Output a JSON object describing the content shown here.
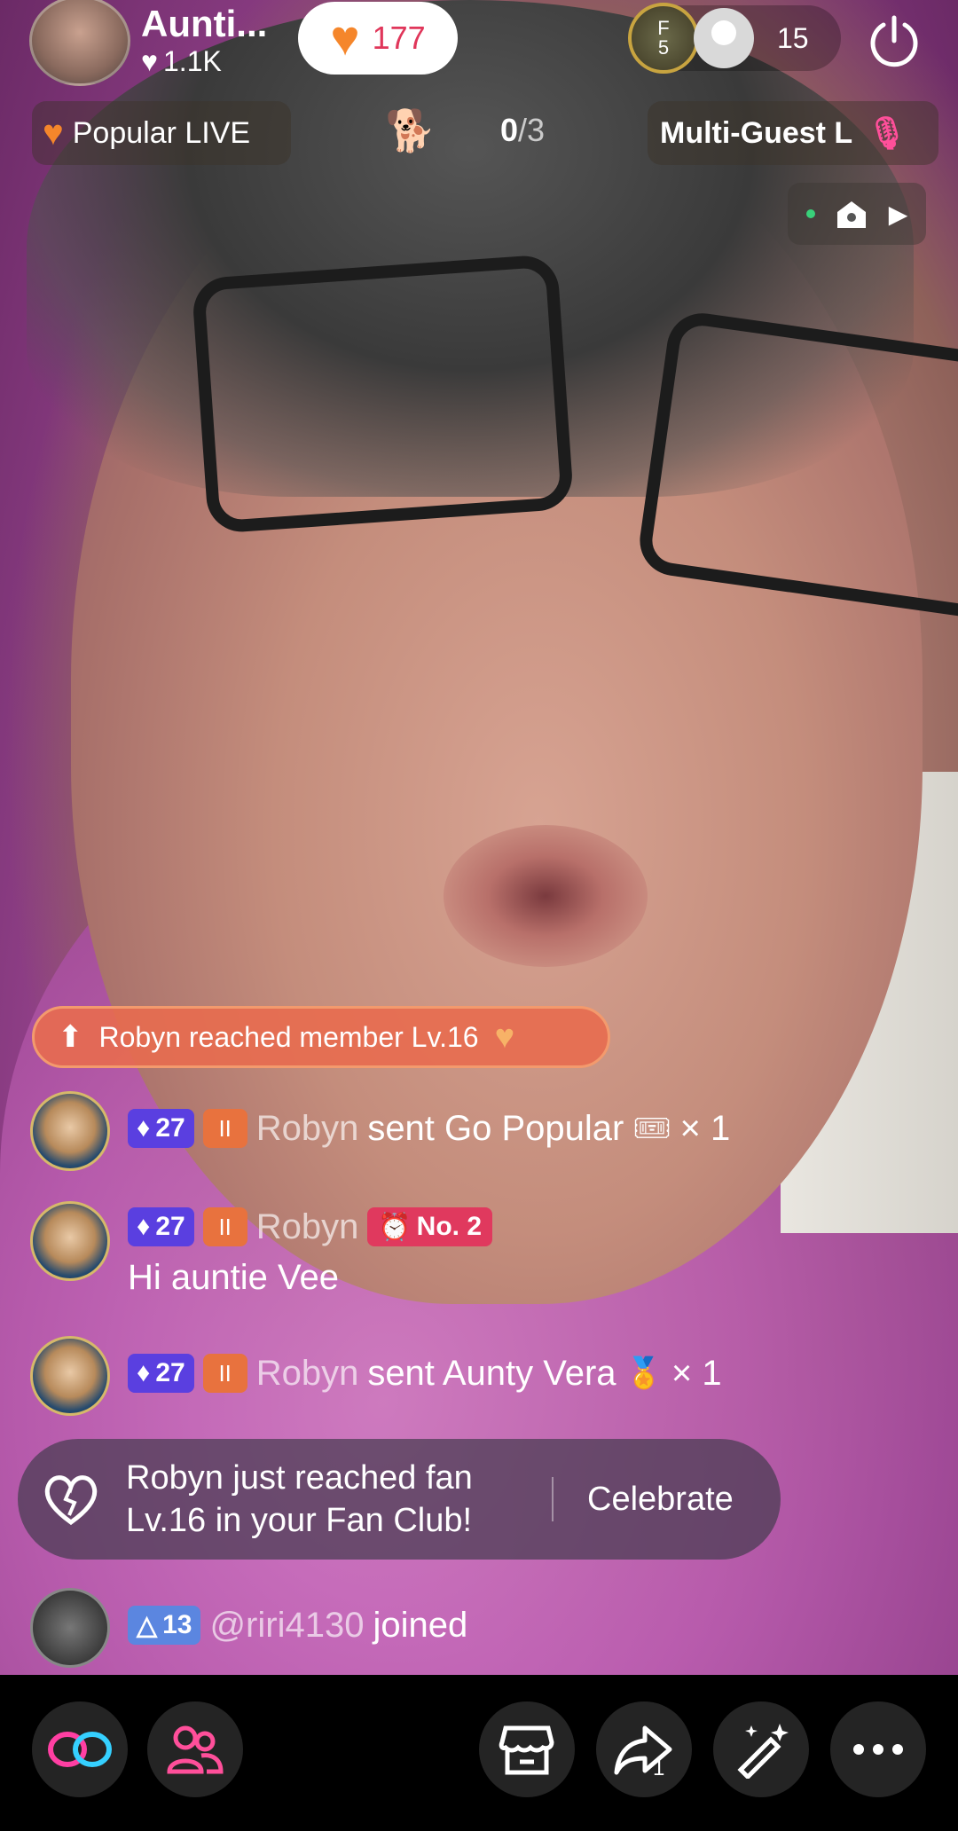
{
  "host": {
    "name": "Aunti...",
    "likes": "1.1K"
  },
  "like_count": "177",
  "viewers": {
    "top_badge_letter": "F",
    "top_badge_num": "5",
    "count": "15"
  },
  "popular_live": "Popular LIVE",
  "guests": {
    "current": "0",
    "total": "/3"
  },
  "multi_guest": "Multi-Guest L",
  "level_banner": "Robyn reached member Lv.16",
  "chat": [
    {
      "level": "27",
      "user": "Robyn",
      "text": "sent Go Popular",
      "mult": "× 1"
    },
    {
      "level": "27",
      "user": "Robyn",
      "rank": "No. 2",
      "message": "Hi auntie Vee"
    },
    {
      "level": "27",
      "user": "Robyn",
      "text": "sent Aunty Vera",
      "mult": "× 1"
    }
  ],
  "fan_toast": {
    "message": "Robyn just reached fan Lv.16 in your Fan Club!",
    "action": "Celebrate"
  },
  "join": {
    "level": "13",
    "user": "@riri4130",
    "text": "joined"
  },
  "share_count": "1",
  "colors": {
    "accent_orange": "#f5862b",
    "like_red": "#e0365a",
    "rank_pink": "#e0395e",
    "level_purple": "#5a3fe0"
  }
}
